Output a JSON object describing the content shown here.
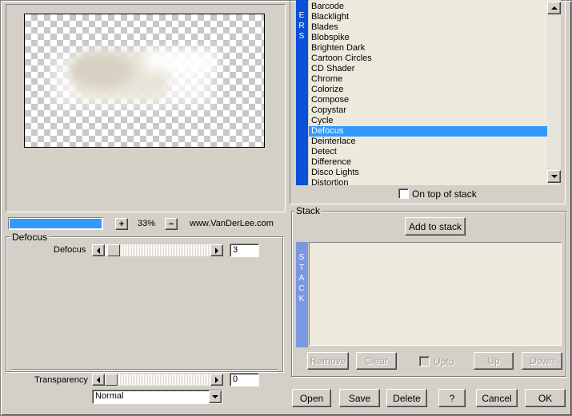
{
  "colors": {
    "accent": "#3399ff",
    "side_strip": "#0a50d8",
    "stack_strip": "#7a98e0",
    "list_bg": "#ede9dc"
  },
  "zoom": {
    "plus_label": "+",
    "minus_label": "−",
    "value": "33%",
    "progress": 1.0
  },
  "credit": "www.VanDerLee.com",
  "filter_group": {
    "legend": "Defocus",
    "param_label": "Defocus",
    "param_value": "3",
    "param_slider_fraction": 0.03
  },
  "transparency": {
    "label": "Transparency",
    "value": "0",
    "slider_fraction": 0.0
  },
  "blend_mode": {
    "selected": "Normal"
  },
  "filters": {
    "side_letters": [
      "E",
      "R",
      "S"
    ],
    "items": [
      "Barcode",
      "Blacklight",
      "Blades",
      "Blobspike",
      "Brighten Dark",
      "Cartoon Circles",
      "CD Shader",
      "Chrome",
      "Colorize",
      "Compose",
      "Copystar",
      "Cycle",
      "Defocus",
      "Deinterlace",
      "Detect",
      "Difference",
      "Disco Lights",
      "Distortion"
    ],
    "selected": "Defocus"
  },
  "on_top_of_stack": "On top of stack",
  "stack": {
    "legend": "Stack",
    "add_label": "Add to stack",
    "side_letters": [
      "S",
      "T",
      "A",
      "C",
      "K"
    ],
    "remove_label": "Remove",
    "clear_label": "Clear",
    "upto_label": "Upto",
    "up_label": "Up",
    "down_label": "Down"
  },
  "bottom": {
    "open": "Open",
    "save": "Save",
    "delete": "Delete",
    "help": "?",
    "cancel": "Cancel",
    "ok": "OK"
  }
}
